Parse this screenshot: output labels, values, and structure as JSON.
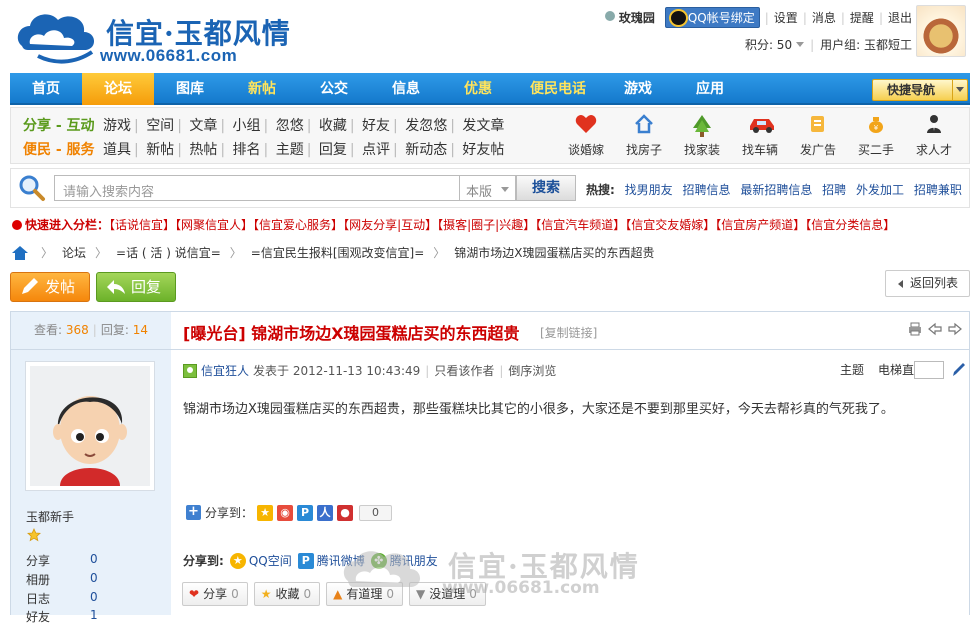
{
  "header": {
    "logo_text": "信宜·玉都风情",
    "logo_url": "www.06681.com",
    "username": "玫瑰园",
    "qq_bind": "QQ帐号绑定",
    "links": [
      "设置",
      "消息",
      "提醒",
      "退出"
    ],
    "points_label": "积分: 50",
    "usergroup": "用户组: 玉都短工"
  },
  "nav": {
    "items": [
      "首页",
      "论坛",
      "图库",
      "新帖",
      "公交",
      "信息",
      "优惠",
      "便民电话",
      "游戏",
      "应用"
    ],
    "quick_nav": "快捷导航"
  },
  "subnav": {
    "row1_lead": "分享 - 互动",
    "row1_items": [
      "游戏",
      "空间",
      "文章",
      "小组",
      "忽悠",
      "收藏",
      "好友",
      "发忽悠",
      "发文章"
    ],
    "row2_lead": "便民 - 服务",
    "row2_items": [
      "道具",
      "新帖",
      "热帖",
      "排名",
      "主题",
      "回复",
      "点评",
      "新动态",
      "好友帖"
    ],
    "icons": [
      {
        "label": "谈婚嫁",
        "icon": "heart-icon"
      },
      {
        "label": "找房子",
        "icon": "house-icon"
      },
      {
        "label": "找家装",
        "icon": "tree-icon"
      },
      {
        "label": "找车辆",
        "icon": "car-icon"
      },
      {
        "label": "发广告",
        "icon": "ad-icon"
      },
      {
        "label": "买二手",
        "icon": "bag-icon"
      },
      {
        "label": "求人才",
        "icon": "person-icon"
      }
    ]
  },
  "search": {
    "placeholder": "请输入搜索内容",
    "scope": "本版",
    "button": "搜索",
    "hot_label": "热搜:",
    "hot_items": [
      "找男朋友",
      "招聘信息",
      "最新招聘信息",
      "招聘",
      "外发加工",
      "招聘兼职"
    ]
  },
  "quick_enter": {
    "lead": "快速进入分栏：",
    "items": [
      "【话说信宜】",
      "【网聚信宜人】",
      "【信宜爱心服务】",
      "【网友分享|互动】",
      "【摄客|圈子|兴趣】",
      "【信宜汽车频道】",
      "【信宜交友婚嫁】",
      "【信宜房产频道】",
      "【信宜分类信息】"
    ]
  },
  "breadcrumb": [
    "论坛",
    "=话 ( 活 ) 说信宜=",
    "=信宜民生报料[围观改变信宜]=",
    "锦湖市场边X瑰园蛋糕店买的东西超贵"
  ],
  "buttons": {
    "post": "发帖",
    "reply": "回复",
    "back": "返回列表"
  },
  "post": {
    "views_label": "查看:",
    "views": "368",
    "replies_label": "回复:",
    "replies": "14",
    "title": "[曝光台] 锦湖市场边X瑰园蛋糕店买的东西超贵",
    "copy_link": "[复制链接]",
    "author": "信宜狂人",
    "posted_at": "发表于 2012-11-13 10:43:49",
    "only_author": "只看该作者",
    "reverse": "倒序浏览",
    "floor_labels": [
      "主题",
      "电梯直达"
    ],
    "content": "锦湖市场边X瑰园蛋糕店买的东西超贵，那些蛋糕块比其它的小很多，大家还是不要到那里买好，今天去帮衫真的气死我了。",
    "share_to_label": "分享到：",
    "share_count": "0",
    "share2_label": "分享到:",
    "share2_items": [
      "QQ空间",
      "腾讯微博",
      "腾讯朋友"
    ],
    "actions": [
      {
        "label": "分享",
        "count": "0"
      },
      {
        "label": "收藏",
        "count": "0"
      },
      {
        "label": "有道理",
        "count": "0"
      },
      {
        "label": "没道理",
        "count": "0"
      }
    ]
  },
  "user": {
    "name": "玉都新手",
    "stats": [
      {
        "label": "分享",
        "value": "0"
      },
      {
        "label": "相册",
        "value": "0"
      },
      {
        "label": "日志",
        "value": "0"
      },
      {
        "label": "好友",
        "value": "1"
      }
    ]
  },
  "watermark": {
    "text": "信宜·玉都风情",
    "url": "www.06681.com"
  },
  "colors": {
    "nav_blue": "#1479cc",
    "nav_active": "#f59c0a",
    "title_red": "#cc0000",
    "link_blue": "#1f4f9a"
  }
}
